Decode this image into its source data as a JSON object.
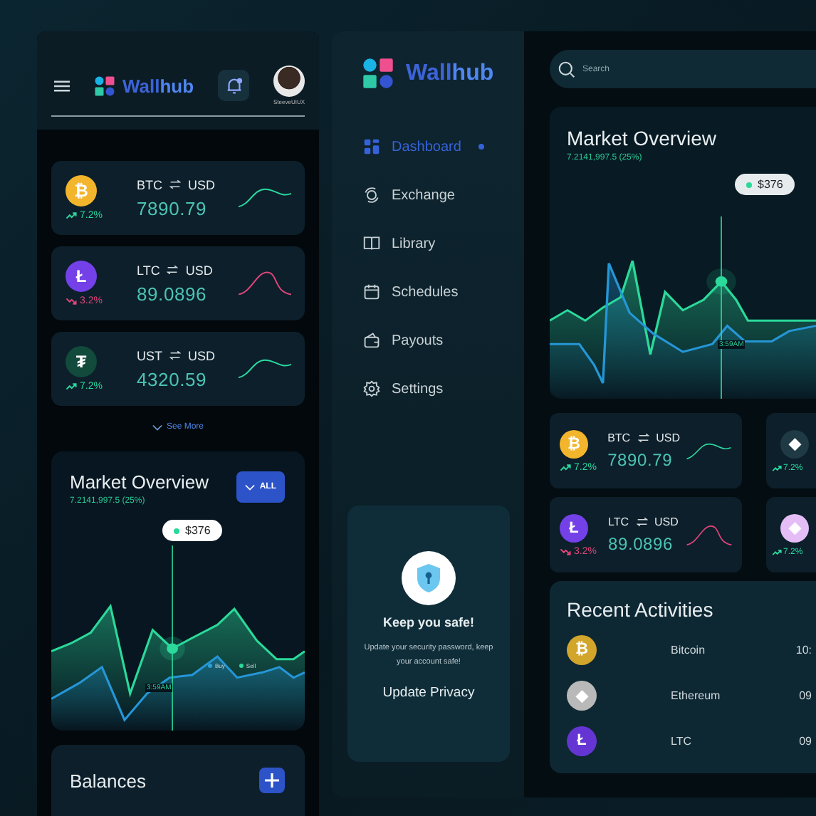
{
  "mobile": {
    "brand": {
      "part_1": "Wall",
      "part_2": "hub"
    },
    "user": {
      "name": "SteeveUIUX"
    },
    "coins": [
      {
        "symbol": "₿",
        "color": "#f2b52c",
        "base": "BTC",
        "quote": "USD",
        "price": "7890.79",
        "change": "7.2%",
        "kind": "up"
      },
      {
        "symbol": "Ł",
        "color": "#7441e8",
        "base": "LTC",
        "quote": "USD",
        "price": "89.0896",
        "change": "3.2%",
        "kind": "down"
      },
      {
        "symbol": "₮",
        "color": "#124a3b",
        "base": "UST",
        "quote": "USD",
        "price": "4320.59",
        "change": "7.2%",
        "kind": "up"
      }
    ],
    "see_more": "See More",
    "market": {
      "title": "Market Overview",
      "subtitle": "7.2141,997.5 (25%)",
      "filter": "ALL",
      "tooltip": "$376",
      "time": "3:59AM",
      "legend": [
        {
          "label": "Buy",
          "color": "#2a9fd6"
        },
        {
          "label": "Sell",
          "color": "#2bd99a"
        }
      ]
    },
    "balances": {
      "title": "Balances"
    }
  },
  "desktop": {
    "brand": {
      "part_1": "Wall",
      "part_2": "hub"
    },
    "nav": [
      {
        "label": "Dashboard",
        "kind": "grid",
        "selected": true
      },
      {
        "label": "Exchange",
        "kind": "exchange",
        "selected": false
      },
      {
        "label": "Library",
        "kind": "book",
        "selected": false
      },
      {
        "label": "Schedules",
        "kind": "calendar",
        "selected": false
      },
      {
        "label": "Payouts",
        "kind": "wallet",
        "selected": false
      },
      {
        "label": "Settings",
        "kind": "gear",
        "selected": false
      }
    ],
    "promo": {
      "title": "Keep you safe!",
      "text": "Update your security password, keep your account safe!",
      "action": "Update Privacy"
    },
    "search": {
      "placeholder": "Search"
    },
    "market": {
      "title": "Market Overview",
      "subtitle": "7.2141,997.5 (25%)",
      "tooltip": "$376",
      "time": "3:59AM"
    },
    "coins": [
      {
        "symbol": "₿",
        "color": "#f2b52c",
        "base": "BTC",
        "quote": "USD",
        "price": "7890.79",
        "change": "7.2%",
        "kind": "up"
      },
      {
        "symbol": "Ł",
        "color": "#7441e8",
        "base": "LTC",
        "quote": "USD",
        "price": "89.0896",
        "change": "3.2%",
        "kind": "down"
      }
    ],
    "more_coins": [
      {
        "symbol": "◆",
        "color": "#1f3a44",
        "change": "7.2%",
        "kind": "up"
      },
      {
        "symbol": "◆",
        "color": "#e4bdf6",
        "change": "7.2%",
        "kind": "up"
      }
    ],
    "activities": {
      "title": "Recent Activities",
      "rows": [
        {
          "symbol": "₿",
          "color": "#d2a52b",
          "name": "Bitcoin",
          "time": "10:"
        },
        {
          "symbol": "◆",
          "color": "#b9b9b9",
          "name": "Ethereum",
          "time": "09"
        },
        {
          "symbol": "Ł",
          "color": "#6535d4",
          "name": "LTC",
          "time": "09"
        }
      ]
    }
  }
}
